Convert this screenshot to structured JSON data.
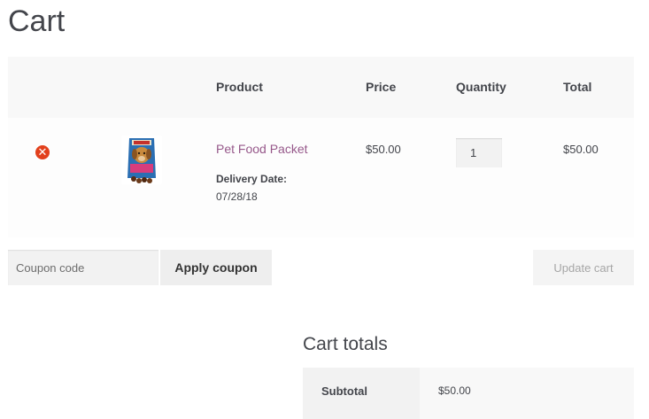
{
  "page": {
    "title": "Cart"
  },
  "cart": {
    "columns": {
      "product": "Product",
      "price": "Price",
      "quantity": "Quantity",
      "total": "Total"
    },
    "items": [
      {
        "remove_icon": "remove-icon",
        "remove_glyph": "✕",
        "thumbnail": "dog-food-packet-image",
        "name": "Pet Food Packet",
        "meta_label": "Delivery Date:",
        "meta_value": "07/28/18",
        "price": "$50.00",
        "quantity": "1",
        "total": "$50.00"
      }
    ]
  },
  "actions": {
    "coupon_placeholder": "Coupon code",
    "apply_label": "Apply coupon",
    "update_label": "Update cart"
  },
  "totals": {
    "title": "Cart totals",
    "subtotal_label": "Subtotal",
    "subtotal_value": "$50.00"
  },
  "colors": {
    "link": "#96588a",
    "remove": "#e2401c",
    "header_bg": "#f8f8f8",
    "text": "#43454b"
  }
}
